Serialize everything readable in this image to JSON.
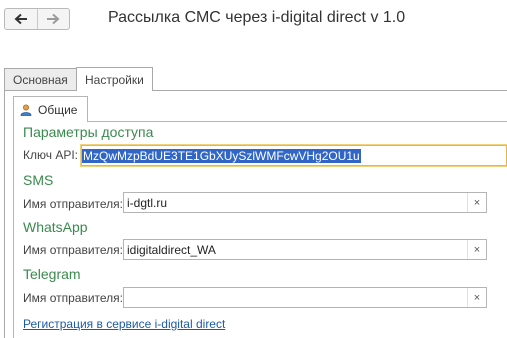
{
  "window": {
    "title": "Рассылка СМС через i-digital direct v 1.0"
  },
  "tabs": [
    {
      "label": "Основная",
      "active": false
    },
    {
      "label": "Настройки",
      "active": true
    }
  ],
  "subtab": {
    "label": "Общие",
    "icon": "user-icon"
  },
  "access": {
    "title": "Параметры доступа",
    "api_label": "Ключ API:",
    "api_value": "MzQwMzpBdUE3TE1GbXUySzlWMFcwVHg2OU1u"
  },
  "sms": {
    "title": "SMS",
    "sender_label": "Имя отправителя:",
    "sender_value": "i-dgtl.ru"
  },
  "whatsapp": {
    "title": "WhatsApp",
    "sender_label": "Имя отправителя:",
    "sender_value": "idigitaldirect_WA"
  },
  "telegram": {
    "title": "Telegram",
    "sender_label": "Имя отправителя:",
    "sender_value": ""
  },
  "clear_symbol": "×",
  "register_link": "Регистрация в сервисе i-digital direct",
  "colors": {
    "section_title": "#3a8a4e",
    "link": "#1d5aa6",
    "selection": "#3166c6",
    "focus_border": "#e2b84a"
  }
}
